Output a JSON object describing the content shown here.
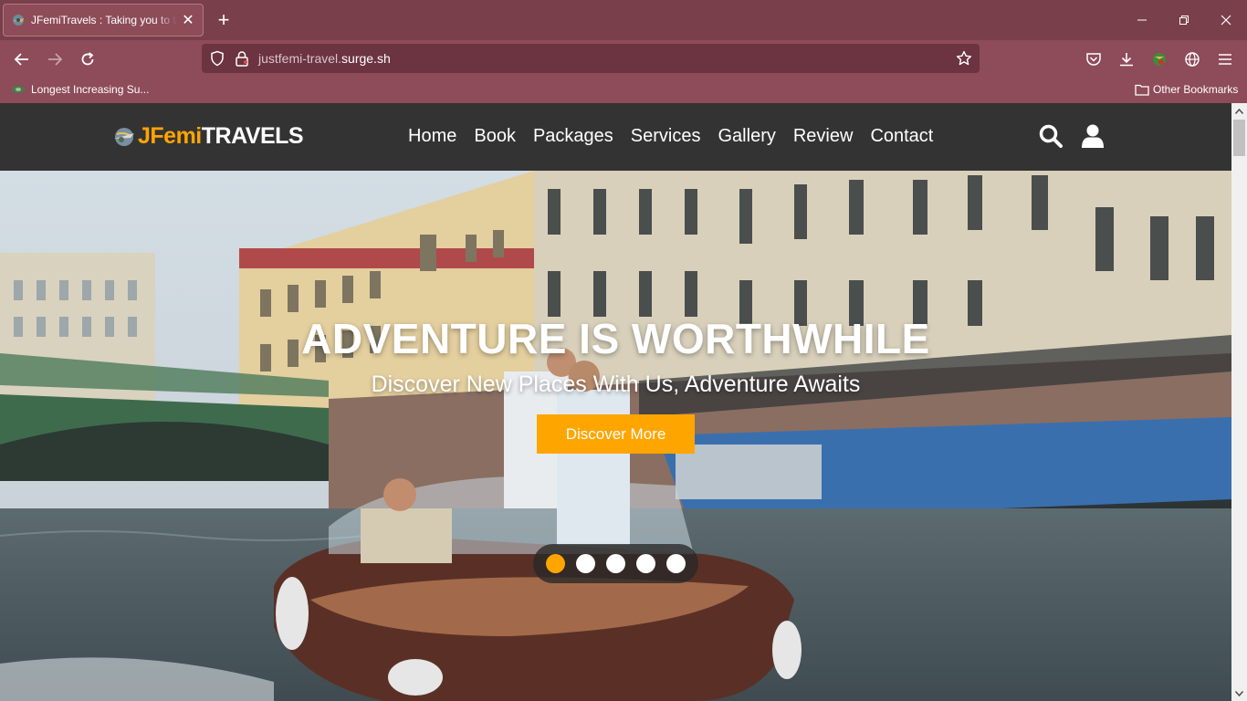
{
  "browser": {
    "tab_title": "JFemiTravels : Taking you to the world",
    "tab_close": "✕",
    "new_tab": "+",
    "url_prefix": "justfemi-travel.",
    "url_domain": "surge.sh",
    "bookmark_1": "Longest Increasing Su...",
    "other_bookmarks": "Other Bookmarks"
  },
  "site": {
    "logo_part1": "JFemi",
    "logo_part2": "TRAVELS",
    "nav": [
      "Home",
      "Book",
      "Packages",
      "Services",
      "Gallery",
      "Review",
      "Contact"
    ]
  },
  "hero": {
    "title": "ADVENTURE IS WORTHWHILE",
    "subtitle": "Discover New Places With Us, Adventure Awaits",
    "button": "Discover More",
    "slides": 5,
    "active_slide": 1
  },
  "colors": {
    "accent": "#ffa500",
    "header_bg": "#333333",
    "browser_frame": "#793f4a"
  },
  "icons": {
    "search": "search-icon",
    "user": "user-icon"
  }
}
